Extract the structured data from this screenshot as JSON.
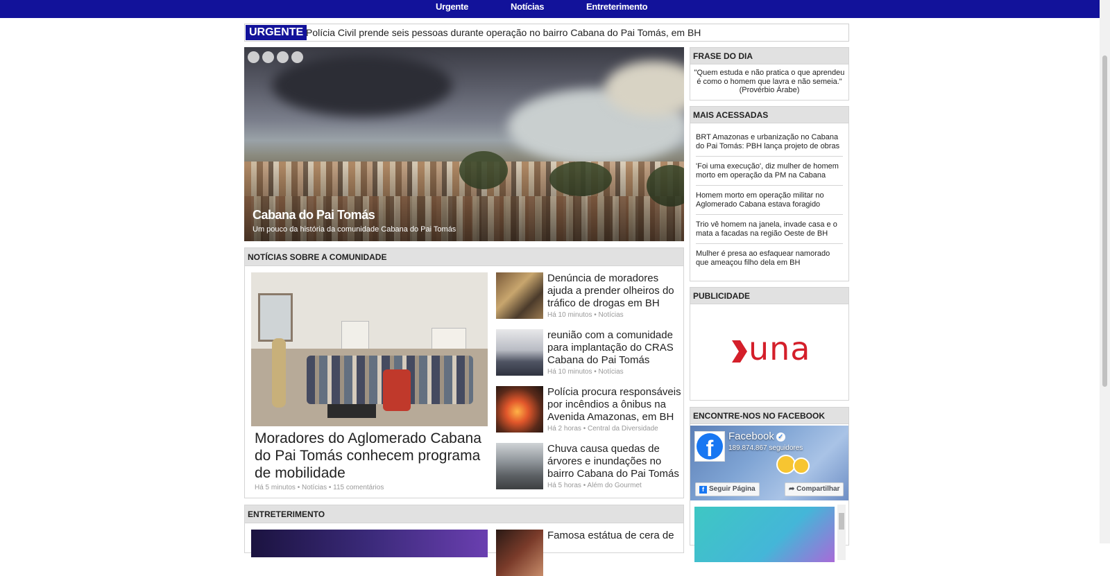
{
  "nav": {
    "items": [
      {
        "label": "Urgente"
      },
      {
        "label": "Notícias"
      },
      {
        "label": "Entreterimento"
      }
    ]
  },
  "urgent": {
    "label": "URGENTE",
    "text": "Polícia Civil prende seis pessoas durante operação no bairro Cabana do Pai Tomás, em BH"
  },
  "hero": {
    "title": "Cabana do Pai Tomás",
    "subtitle": "Um pouco da história da comunidade Cabana do Pai Tomás",
    "slide_count": 4
  },
  "community": {
    "heading": "NOTÍCIAS SOBRE A COMUNIDADE",
    "main": {
      "title": "Moradores do Aglomerado Cabana do Pai Tomás conhecem programa de mobilidade",
      "meta": "Há 5 minutos • Notícias • 115 comentários"
    },
    "side": [
      {
        "title": "Denúncia de moradores ajuda a prender olheiros do tráfico de drogas em BH",
        "meta": "Há 10 minutos • Notícias"
      },
      {
        "title": "reunião com a comunidade para implantação do CRAS Cabana do Pai Tomás",
        "meta": "Há 10 minutos • Notícias"
      },
      {
        "title": "Polícia procura responsáveis por incêndios a ônibus na Avenida Amazonas, em BH",
        "meta": "Há 2 horas • Central da Diversidade"
      },
      {
        "title": "Chuva causa quedas de árvores e inundações no bairro Cabana do Pai Tomás",
        "meta": "Há 5 horas • Além do Gourmet"
      }
    ]
  },
  "entertainment": {
    "heading": "ENTRETERIMENTO",
    "side": [
      {
        "title": "Famosa estátua de cera de"
      }
    ]
  },
  "sidebar": {
    "quote": {
      "heading": "FRASE DO DIA",
      "text": "\"Quem estuda e não pratica o que aprendeu é como o homem que lavra e não semeia.\" (Provérbio Árabe)"
    },
    "most_read": {
      "heading": "MAIS ACESSADAS",
      "items": [
        "BRT Amazonas e urbanização no Cabana do Pai Tomás: PBH lança projeto de obras",
        "'Foi uma execução', diz mulher de homem morto em operação da PM na Cabana",
        "Homem morto em operação militar no Aglomerado Cabana estava foragido",
        "Trio vê homem na janela, invade casa e o mata a facadas na região Oeste de BH",
        "Mulher é presa ao esfaquear namorado que ameaçou filho dela em BH"
      ]
    },
    "ad": {
      "heading": "PUBLICIDADE",
      "brand": "una",
      "brand_color": "#d41f2a"
    },
    "facebook": {
      "heading": "ENCONTRE-NOS NO FACEBOOK",
      "name": "Facebook",
      "followers": "189.874.867 seguidores",
      "follow_label": "Seguir Página",
      "share_label": "Compartilhar"
    }
  },
  "colors": {
    "nav_bg": "#12129a",
    "section_head_bg": "#e1e1e1"
  }
}
